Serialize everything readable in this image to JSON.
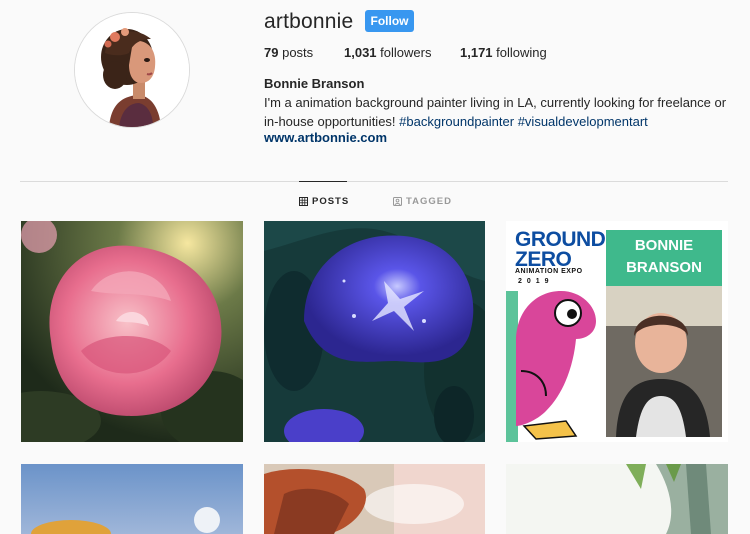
{
  "profile": {
    "username": "artbonnie",
    "follow_label": "Follow",
    "stats": {
      "posts_count": "79",
      "posts_label": "posts",
      "followers_count": "1,031",
      "followers_label": "followers",
      "following_count": "1,171",
      "following_label": "following"
    },
    "full_name": "Bonnie Branson",
    "bio": {
      "line1": "I'm a animation background painter living in LA, currently looking for freelance or",
      "line2_prefix": "in-house opportunities! ",
      "hashtag1": "#backgroundpainter",
      "hashtag2": "#visualdevelopmentart"
    },
    "website": "www.artbonnie.com"
  },
  "tabs": [
    {
      "label": "POSTS",
      "icon": "grid-icon",
      "active": true
    },
    {
      "label": "TAGGED",
      "icon": "tagged-icon",
      "active": false
    }
  ],
  "posts": {
    "poster": {
      "ground_line1": "GROUND",
      "ground_line2": "ZERO",
      "expo": "ANIMATION EXPO",
      "year": "2019",
      "name_line1": "BONNIE",
      "name_line2": "BRANSON"
    }
  },
  "colors": {
    "background": "#fafafa",
    "follow_button": "#3897f0",
    "link": "#003569",
    "divider": "#dbdbdb",
    "poster_banner": "#3fb98c"
  }
}
